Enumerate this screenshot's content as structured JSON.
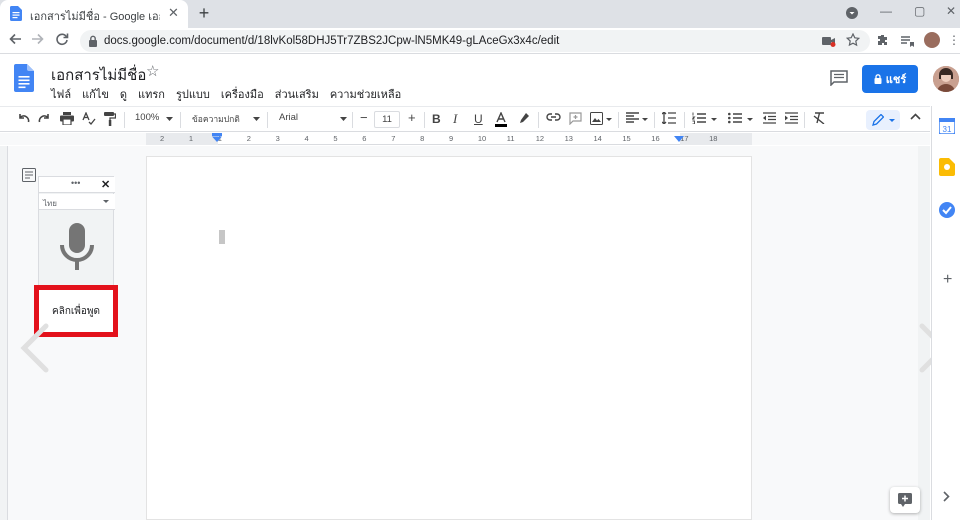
{
  "browser": {
    "tab_title": "เอกสารไม่มีชื่อ - Google เอกสาร",
    "tab_close": "✕",
    "new_tab": "+",
    "url": "docs.google.com/document/d/18lvKol58DHJ5Tr7ZBS2JCpw-lN5MK49-gLAceGx3x4c/edit",
    "window_controls": [
      "—",
      "▢",
      "✕"
    ]
  },
  "docs": {
    "title": "เอกสารไม่มีชื่อ",
    "menu": [
      "ไฟล์",
      "แก้ไข",
      "ดู",
      "แทรก",
      "รูปแบบ",
      "เครื่องมือ",
      "ส่วนเสริม",
      "ความช่วยเหลือ"
    ],
    "share_label": "แชร์",
    "accent": "#1a73e8"
  },
  "format_toolbar": {
    "zoom": "100%",
    "style": "ข้อความปกติ",
    "font": "Arial",
    "font_size": "11"
  },
  "ruler": {
    "ticks": [
      "2",
      "1",
      "1",
      "2",
      "3",
      "4",
      "5",
      "6",
      "7",
      "8",
      "9",
      "10",
      "11",
      "12",
      "13",
      "14",
      "15",
      "16",
      "17",
      "18"
    ]
  },
  "voice_typing": {
    "menu": "•••",
    "close": "✕",
    "language": "ไทย",
    "click_to_speak": "คลิกเพื่อพูด",
    "highlight_color": "#e3111b"
  }
}
